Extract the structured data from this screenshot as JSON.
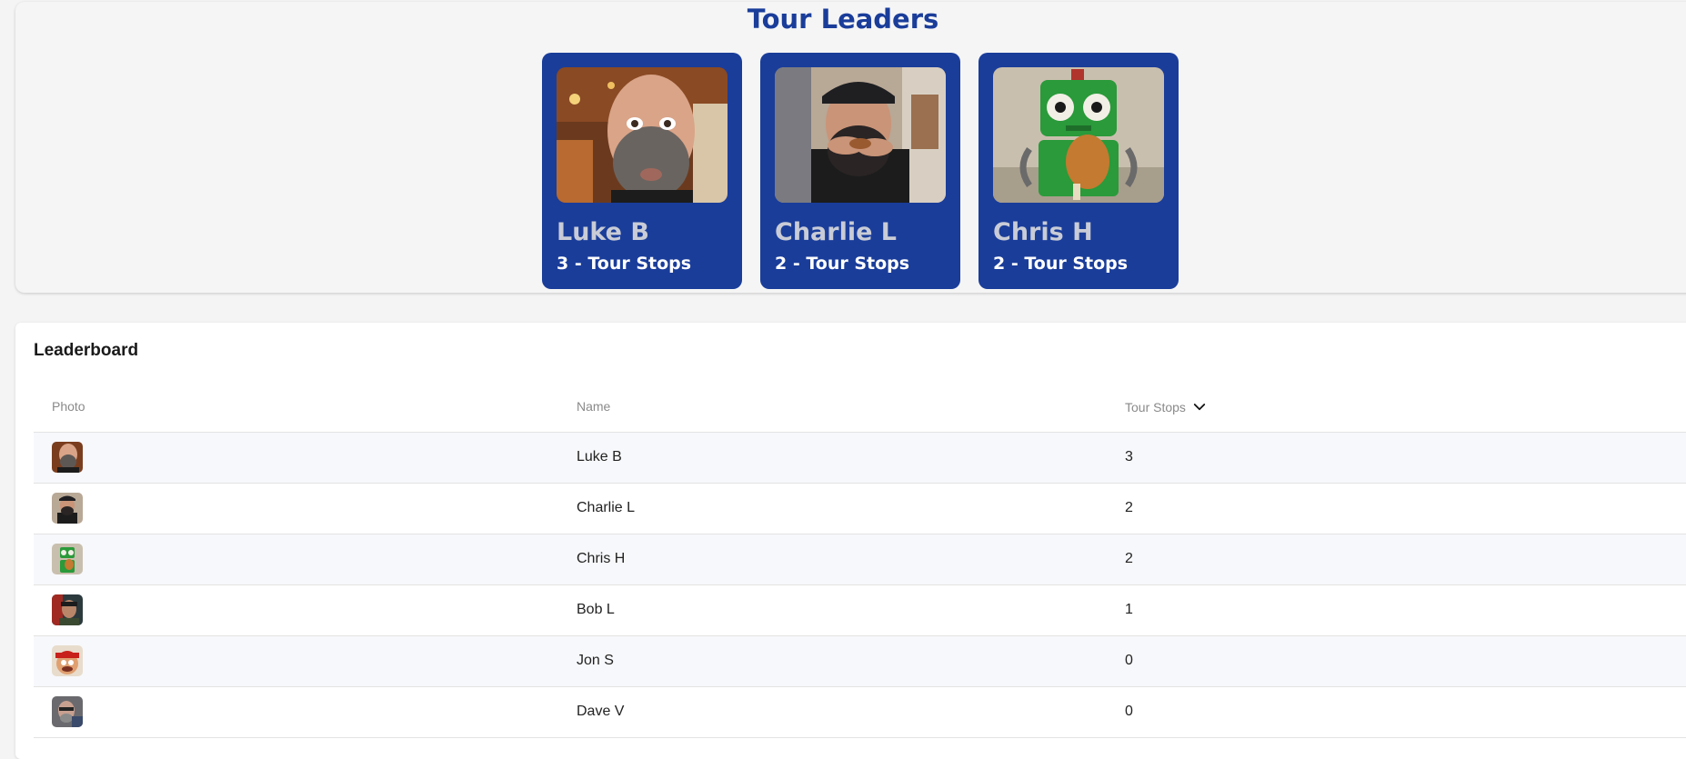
{
  "leaders": {
    "title": "Tour Leaders",
    "cards": [
      {
        "name": "Luke B",
        "stops": "3 - Tour Stops",
        "photo_icon": "bearded-man-portrait"
      },
      {
        "name": "Charlie L",
        "stops": "2 - Tour Stops",
        "photo_icon": "man-eating-wing-portrait"
      },
      {
        "name": "Chris H",
        "stops": "2 - Tour Stops",
        "photo_icon": "green-robot-portrait"
      }
    ]
  },
  "leaderboard": {
    "title": "Leaderboard",
    "columns": {
      "photo": "Photo",
      "name": "Name",
      "stops": "Tour Stops"
    },
    "sort_icon": "chevron-down-icon",
    "rows": [
      {
        "name": "Luke B",
        "stops": "3"
      },
      {
        "name": "Charlie L",
        "stops": "2"
      },
      {
        "name": "Chris H",
        "stops": "2"
      },
      {
        "name": "Bob L",
        "stops": "1"
      },
      {
        "name": "Jon S",
        "stops": "0"
      },
      {
        "name": "Dave V",
        "stops": "0"
      }
    ]
  },
  "colors": {
    "brand_blue": "#1a3d9a",
    "card_name": "#c9ccd6",
    "alt_row": "#f7f8fb"
  }
}
